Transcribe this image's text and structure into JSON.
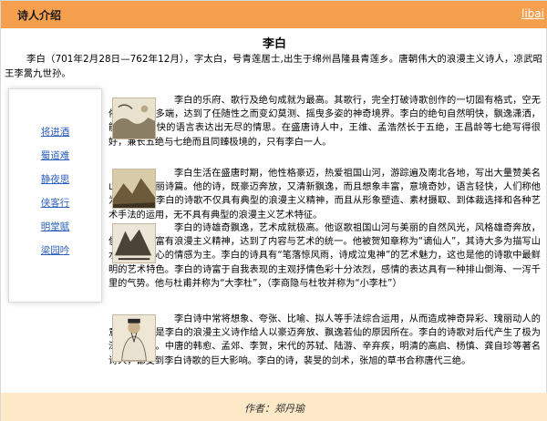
{
  "header": {
    "title": "诗人介绍",
    "link_label": "libai"
  },
  "page_title": "李白",
  "intro": "李白（701年2月28日—762年12月），字太白，号青莲居士,出生于绵州昌隆县青莲乡。唐朝伟大的浪漫主义诗人，凉武昭王李暠九世孙。",
  "sidebar": {
    "items": [
      {
        "label": "将进酒"
      },
      {
        "label": "蜀道难"
      },
      {
        "label": "静夜思"
      },
      {
        "label": "侠客行"
      },
      {
        "label": "明堂赋"
      },
      {
        "label": "梁园吟"
      }
    ]
  },
  "paragraphs": [
    {
      "text": "李白的乐府、歌行及绝句成就为最高。其歌行，完全打破诗歌创作的一切固有格式，空无依傍，笔法多端，达到了任随性之而变幻莫测、摇曳多姿的神奇境界。李白的绝句自然明快，飘逸潇洒，能以简洁明快的语言表达出无尽的情思。在盛唐诗人中，王维、孟浩然长于五绝，王昌龄等七绝写得很好，兼长五绝与七绝而且同臻极境的，只有李白一人。"
    },
    {
      "text": "李白生活在盛唐时期，他性格豪迈，热爱祖国山河，游踪遍及南北各地，写出大量赞美名山大川的壮丽诗篇。他的诗，既豪迈奔放，又清新飘逸，而且想象丰富，意境奇妙，语言轻快，人们称他为“诗仙”。李白的诗歌不仅具有典型的浪漫主义精神，而且从形象塑造、素材摄取、到体裁选择和各种艺术手法的运用，无不具有典型的浪漫主义艺术特征。"
    },
    {
      "text": "李白的诗雄奇飘逸，艺术成就极高。他讴歌祖国山河与美丽的自然风光，风格雄奇奔放，俊逸清新，富有浪漫主义精神，达到了内容与艺术的统一。他被贺知章称为“谪仙人”，其诗大多为描写山水和抒发内心的情感为主。李白的诗具有“笔落惊风雨，诗成泣鬼神”的艺术魅力，这也是他的诗歌中最鲜明的艺术特色。李白的诗富于自我表现的主观抒情色彩十分浓烈，感情的表达具有一种排山倒海、一泻千里的气势。他与杜甫并称为“大李杜”，（李商隐与杜牧并称为“小李杜”）"
    },
    {
      "text": "李白诗中常将想象、夸张、比喻、拟人等手法综合运用，从而造成神奇异彩、瑰丽动人的意境，这就是李白的浪漫主义诗作给人以豪迈奔放、飘逸若仙的原因所在。李白的诗歌对后代产生了极为深远的影响。中唐的韩愈、孟郊、李贺，宋代的苏轼、陆游、辛弃疾，明清的高启、杨慎、龚自珍等著名诗人，都受到李白诗歌的巨大影响。李白的诗，裴旻的剑术，张旭的草书合称唐代三绝。"
    }
  ],
  "images": [
    {
      "icon": "landscape-painting-icon"
    },
    {
      "icon": "mountain-painting-icon"
    },
    {
      "icon": "ink-landscape-icon"
    },
    {
      "icon": "poet-portrait-icon"
    }
  ],
  "footer": {
    "author": "作者：郑丹瑜"
  },
  "colors": {
    "header_bg": "#f5a04f",
    "footer_bg": "#fde8c8",
    "link": "#2b5fbd"
  }
}
